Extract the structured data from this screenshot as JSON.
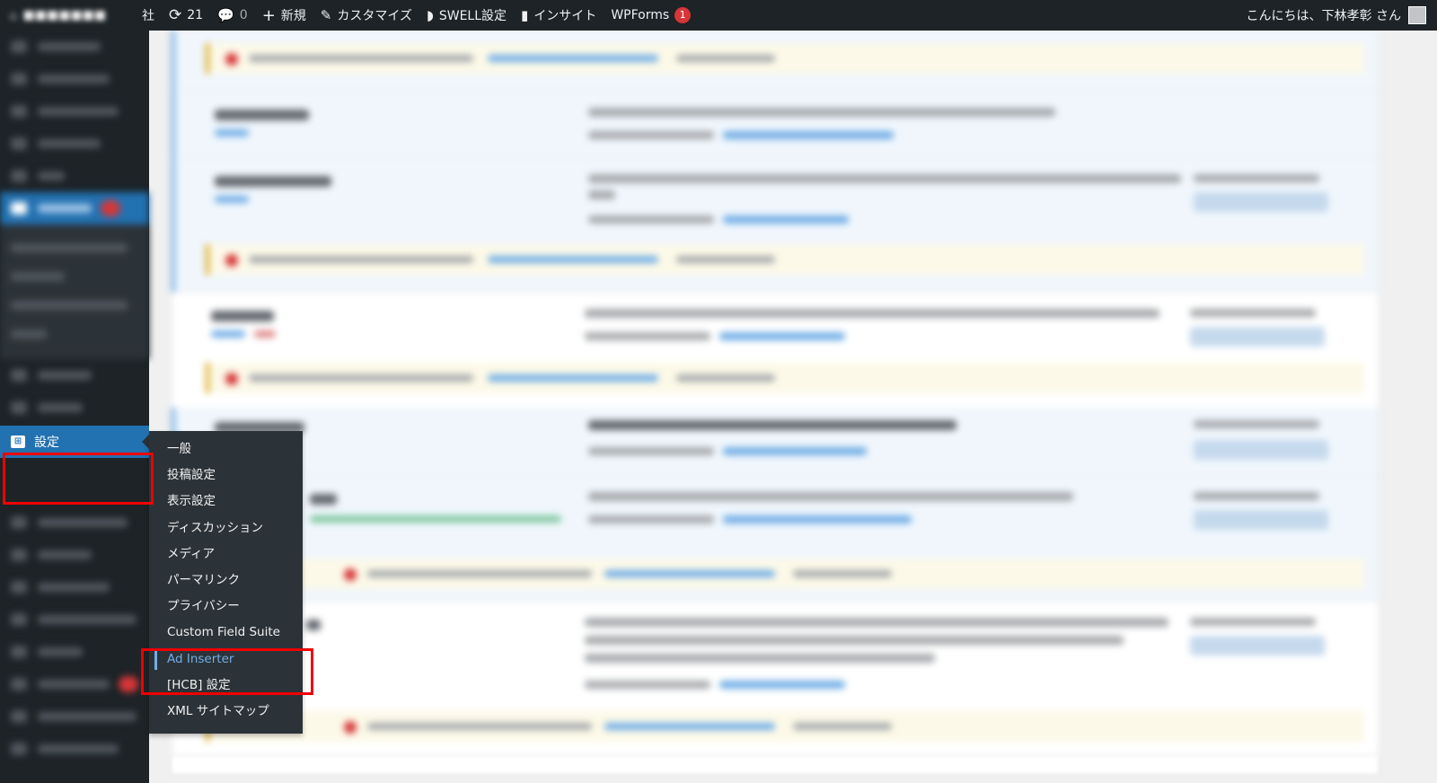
{
  "adminbar": {
    "site_name": "社",
    "updates_count": "21",
    "comments_count": "0",
    "new_label": "新規",
    "customize_label": "カスタマイズ",
    "swell_label": "SWELL設定",
    "insight_label": "インサイト",
    "wpforms_label": "WPForms",
    "wpforms_badge": "1",
    "greeting": "こんにちは、下林孝彰 さん"
  },
  "sidebar": {
    "settings_label": "設定",
    "settings_icon": "settings-sliders-icon"
  },
  "flyout": {
    "items": [
      "一般",
      "投稿設定",
      "表示設定",
      "ディスカッション",
      "メディア",
      "パーマリンク",
      "プライバシー",
      "Custom Field Suite",
      "Ad Inserter",
      "[HCB] 設定",
      "XML サイトマップ"
    ],
    "current_index": 8
  },
  "colors": {
    "adminbar_bg": "#1d2327",
    "menu_active": "#2271b1",
    "submenu_bg": "#2c3338",
    "current_item": "#72aee6",
    "highlight": "#e00000",
    "badge": "#d63638"
  }
}
